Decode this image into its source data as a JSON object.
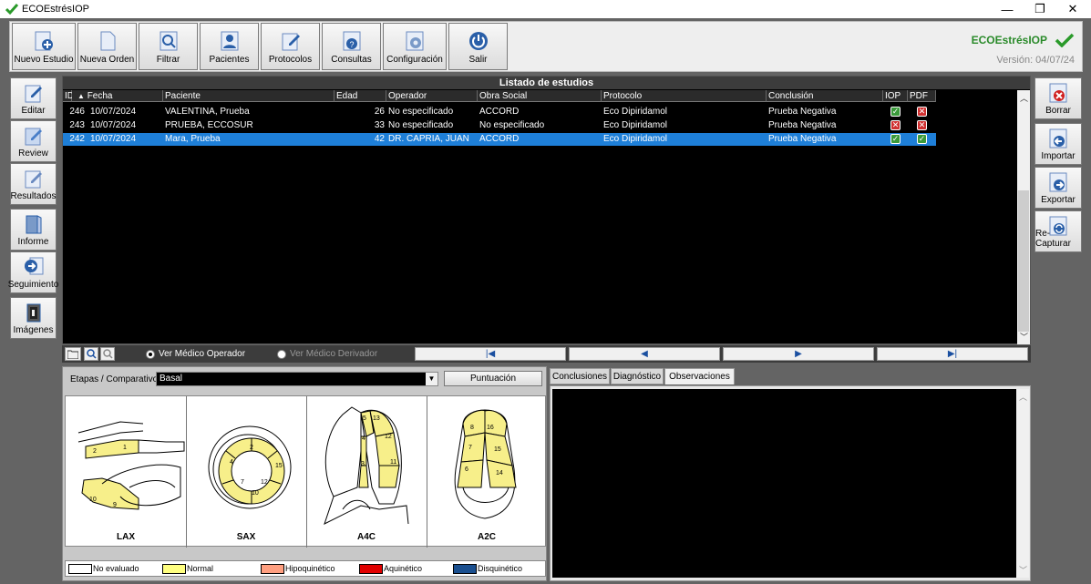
{
  "window": {
    "title": "ECOEstrésIOP"
  },
  "toolbar": {
    "buttons": [
      {
        "label": "Nuevo Estudio",
        "icon": "add-document-icon"
      },
      {
        "label": "Nueva Orden",
        "icon": "blank-document-icon"
      },
      {
        "label": "Filtrar",
        "icon": "magnifier-icon"
      },
      {
        "label": "Pacientes",
        "icon": "person-icon"
      },
      {
        "label": "Protocolos",
        "icon": "edit-document-icon"
      },
      {
        "label": "Consultas",
        "icon": "question-icon"
      },
      {
        "label": "Configuración",
        "icon": "gear-icon"
      },
      {
        "label": "Salir",
        "icon": "power-icon"
      }
    ]
  },
  "brand": {
    "name": "ECOEstrésIOP",
    "version": "Versión: 04/07/24"
  },
  "left_sidebar": [
    {
      "label": "Editar",
      "icon": "edit-icon"
    },
    {
      "label": "Review",
      "icon": "review-icon"
    },
    {
      "label": "Resultados",
      "icon": "results-icon"
    },
    {
      "label": "Informe",
      "icon": "report-icon"
    },
    {
      "label": "Seguimiento",
      "icon": "followup-icon"
    },
    {
      "label": "Imágenes",
      "icon": "images-icon"
    }
  ],
  "right_sidebar": [
    {
      "label": "Borrar",
      "icon": "delete-icon"
    },
    {
      "label": "Importar",
      "icon": "import-icon"
    },
    {
      "label": "Exportar",
      "icon": "export-icon"
    },
    {
      "label": "Re-Capturar",
      "icon": "recapture-icon"
    }
  ],
  "list": {
    "title": "Listado de estudios",
    "columns": [
      "ID",
      "Fecha",
      "Paciente",
      "Edad",
      "Operador",
      "Obra Social",
      "Protocolo",
      "Conclusión",
      "IOP",
      "PDF"
    ],
    "rows": [
      {
        "id": "246",
        "fecha": "10/07/2024",
        "paciente": "VALENTINA, Prueba",
        "edad": "26",
        "operador": "No especificado",
        "obra": "ACCORD",
        "protocolo": "Eco Dipiridamol",
        "conclusion": "Prueba Negativa",
        "iop": "ok",
        "pdf": "no",
        "selected": false
      },
      {
        "id": "243",
        "fecha": "10/07/2024",
        "paciente": "PRUEBA, ECCOSUR",
        "edad": "33",
        "operador": "No especificado",
        "obra": "No especificado",
        "protocolo": "Eco Dipiridamol",
        "conclusion": "Prueba Negativa",
        "iop": "no",
        "pdf": "no",
        "selected": false
      },
      {
        "id": "242",
        "fecha": "10/07/2024",
        "paciente": "Mara, Prueba",
        "edad": "42",
        "operador": "DR. CAPRIA, JUAN",
        "obra": "ACCORD",
        "protocolo": "Eco Dipiridamol",
        "conclusion": "Prueba Negativa",
        "iop": "ok",
        "pdf": "ok",
        "selected": true
      }
    ]
  },
  "nav": {
    "radio_operador": "Ver Médico Operador",
    "radio_derivador": "Ver Médico Derivador",
    "selected": "operador",
    "first": "|◀",
    "prev": "◀",
    "next": "▶",
    "last": "▶|"
  },
  "etapas": {
    "label": "Etapas / Comparativo",
    "value": "Basal",
    "score_button": "Puntuación"
  },
  "views": [
    {
      "name": "LAX",
      "segments": [
        "1",
        "2",
        "9",
        "10"
      ]
    },
    {
      "name": "SAX",
      "segments": [
        "2",
        "4",
        "7",
        "10",
        "12",
        "15"
      ]
    },
    {
      "name": "A4C",
      "segments": [
        "3",
        "4",
        "5",
        "11",
        "12",
        "13"
      ]
    },
    {
      "name": "A2C",
      "segments": [
        "6",
        "7",
        "8",
        "14",
        "15",
        "16"
      ]
    }
  ],
  "legend": [
    {
      "label": "No evaluado",
      "color": "#ffffff"
    },
    {
      "label": "Normal",
      "color": "#ffff80"
    },
    {
      "label": "Hipoquinético",
      "color": "#ff9f80"
    },
    {
      "label": "Aquinético",
      "color": "#e00000"
    },
    {
      "label": "Disquinético",
      "color": "#1a4f8f"
    }
  ],
  "tabs": [
    "Conclusiones",
    "Diagnóstico",
    "Observaciones"
  ],
  "active_tab": "Observaciones",
  "colors": {
    "segment_fill": "#f7ef8a",
    "selection": "#1e7fd8",
    "brand": "#2a8a2a"
  }
}
